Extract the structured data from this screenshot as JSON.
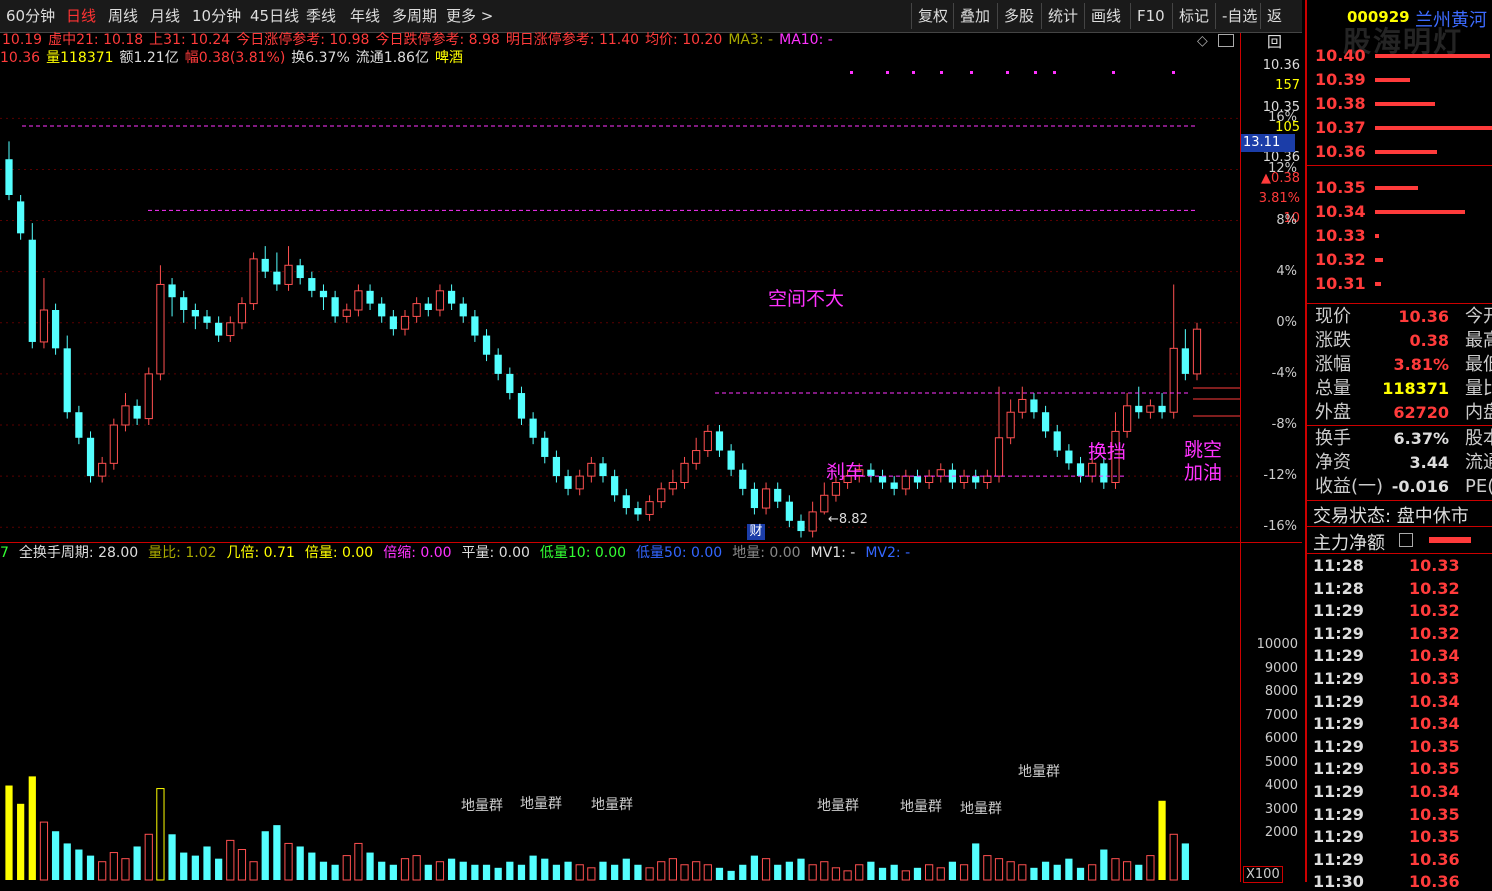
{
  "toolbar": {
    "periods": [
      "60分钟",
      "日线",
      "周线",
      "月线",
      "10分钟",
      "45日线",
      "季线",
      "年线",
      "多周期",
      "更多 >"
    ],
    "active": "日线",
    "actions": [
      "复权",
      "叠加",
      "多股",
      "统计",
      "画线",
      "F10",
      "标记",
      "-自选",
      "返回"
    ]
  },
  "info1": [
    {
      "t": "10.19",
      "c": "#ff3b3b"
    },
    {
      "t": "虚中21: 10.18",
      "c": "#ff3b3b"
    },
    {
      "t": "上31: 10.24",
      "c": "#ff3b3b"
    },
    {
      "t": "今日涨停参考: 10.98",
      "c": "#ff3b3b"
    },
    {
      "t": "今日跌停参考: 8.98",
      "c": "#ff3b3b"
    },
    {
      "t": "明日涨停参考: 11.40",
      "c": "#ff3b3b"
    },
    {
      "t": "均价: 10.20",
      "c": "#ff3b3b"
    },
    {
      "t": "MA3: -",
      "c": "#aaaa00"
    },
    {
      "t": "MA10: -",
      "c": "#ff33ff"
    }
  ],
  "info2": [
    {
      "t": "10.36",
      "c": "#ff3b3b"
    },
    {
      "t": "量118371",
      "c": "#ffff00"
    },
    {
      "t": "额1.21亿",
      "c": "#ddd"
    },
    {
      "t": "幅0.38(3.81%)",
      "c": "#ff3b3b"
    },
    {
      "t": "换6.37%",
      "c": "#ddd"
    },
    {
      "t": "流通1.86亿",
      "c": "#ddd"
    },
    {
      "t": "啤酒",
      "c": "#ffff00"
    }
  ],
  "price_axis": {
    "top_values": [
      {
        "t": "10.36",
        "c": "#ddd"
      },
      {
        "t": "157",
        "c": "#ffff00"
      },
      {
        "t": "10.35",
        "c": "#ddd"
      },
      {
        "t": "105",
        "c": "#ffff00"
      },
      {
        "t": "10.36",
        "c": "#ddd"
      },
      {
        "t": "▲0.38",
        "c": "#ff3b3b"
      },
      {
        "t": "3.81%",
        "c": "#ff3b3b"
      },
      {
        "t": "10",
        "c": "#ff3b3b"
      }
    ],
    "highlight": "13.11",
    "pct_ticks": [
      "16%",
      "12%",
      "8%",
      "4%",
      "0%",
      "-4%",
      "-8%",
      "-12%",
      "-16%"
    ]
  },
  "annotations": {
    "space": "空间不大",
    "brake": "刹车",
    "switch": "换挡",
    "gap1": "跳空",
    "gap2": "加油",
    "low": "←8.82",
    "fin": "财"
  },
  "vol_info": [
    {
      "t": "7",
      "c": "#33ff33"
    },
    {
      "t": "全换手周期: 28.00",
      "c": "#ddd"
    },
    {
      "t": "量比: 1.02",
      "c": "#aaaa00"
    },
    {
      "t": "几倍: 0.71",
      "c": "#ffff00"
    },
    {
      "t": "倍量: 0.00",
      "c": "#ffff00"
    },
    {
      "t": "倍缩: 0.00",
      "c": "#ff33ff"
    },
    {
      "t": "平量: 0.00",
      "c": "#ddd"
    },
    {
      "t": "低量10: 0.00",
      "c": "#33ff33"
    },
    {
      "t": "低量50: 0.00",
      "c": "#3366ff"
    },
    {
      "t": "地量: 0.00",
      "c": "#888"
    },
    {
      "t": "MV1: -",
      "c": "#ddd"
    },
    {
      "t": "MV2: -",
      "c": "#3366ff"
    }
  ],
  "vol_axis": [
    "10000",
    "9000",
    "8000",
    "7000",
    "6000",
    "5000",
    "4000",
    "3000",
    "2000"
  ],
  "vol_unit": "X100",
  "vol_groups": [
    "地量群",
    "地量群",
    "地量群",
    "地量群",
    "地量群",
    "地量群",
    "地量群"
  ],
  "right": {
    "code": "000929",
    "name": "兰州黄河",
    "watermark": "股海明灯",
    "orderbook": [
      {
        "p": "10.40",
        "w": 115
      },
      {
        "p": "10.39",
        "w": 35
      },
      {
        "p": "10.38",
        "w": 60
      },
      {
        "p": "10.37",
        "w": 117
      },
      {
        "p": "10.36",
        "w": 62
      },
      {
        "p": "10.35",
        "w": 43
      },
      {
        "p": "10.34",
        "w": 90
      },
      {
        "p": "10.33",
        "w": 4
      },
      {
        "p": "10.32",
        "w": 8
      },
      {
        "p": "10.31",
        "w": 6
      }
    ],
    "quote": [
      {
        "l": "现价",
        "v": "10.36",
        "c": "#ff3b3b",
        "x": "今开"
      },
      {
        "l": "涨跌",
        "v": "0.38",
        "c": "#ff3b3b",
        "x": "最高"
      },
      {
        "l": "涨幅",
        "v": "3.81%",
        "c": "#ff3b3b",
        "x": "最低"
      },
      {
        "l": "总量",
        "v": "118371",
        "c": "#ffff00",
        "x": "量比"
      },
      {
        "l": "外盘",
        "v": "62720",
        "c": "#ff3b3b",
        "x": "内盘"
      },
      {
        "l": "换手",
        "v": "6.37%",
        "c": "#ddd",
        "x": "股本"
      },
      {
        "l": "净资",
        "v": "3.44",
        "c": "#ddd",
        "x": "流通"
      },
      {
        "l": "收益(一)",
        "v": "-0.016",
        "c": "#ddd",
        "x": "PE(动)"
      }
    ],
    "status": "交易状态: 盘中休市",
    "main_flow": "主力净额",
    "ticks": [
      {
        "t": "11:28",
        "p": "10.33"
      },
      {
        "t": "11:28",
        "p": "10.32"
      },
      {
        "t": "11:29",
        "p": "10.32"
      },
      {
        "t": "11:29",
        "p": "10.32"
      },
      {
        "t": "11:29",
        "p": "10.34"
      },
      {
        "t": "11:29",
        "p": "10.33"
      },
      {
        "t": "11:29",
        "p": "10.34"
      },
      {
        "t": "11:29",
        "p": "10.34"
      },
      {
        "t": "11:29",
        "p": "10.35"
      },
      {
        "t": "11:29",
        "p": "10.35"
      },
      {
        "t": "11:29",
        "p": "10.34"
      },
      {
        "t": "11:29",
        "p": "10.35"
      },
      {
        "t": "11:29",
        "p": "10.35"
      },
      {
        "t": "11:29",
        "p": "10.36"
      },
      {
        "t": "11:30",
        "p": "10.36"
      }
    ]
  },
  "chart_data": {
    "type": "candlestick",
    "pct_range": [
      -17,
      19
    ],
    "reference_lines_pct": [
      15.4,
      8.8,
      -5.5,
      -12.0
    ],
    "candles": [
      [
        12.8,
        10.0,
        14.2,
        9.6
      ],
      [
        9.5,
        7.0,
        10.0,
        6.5
      ],
      [
        6.5,
        -1.5,
        7.8,
        -2.0
      ],
      [
        -1.5,
        1.0,
        3.5,
        -2.0
      ],
      [
        1.0,
        -2.0,
        1.5,
        -2.5
      ],
      [
        -2.0,
        -7.0,
        -1.0,
        -7.5
      ],
      [
        -7.0,
        -9.0,
        -6.5,
        -9.5
      ],
      [
        -9.0,
        -12.0,
        -8.5,
        -12.5
      ],
      [
        -12.0,
        -11.0,
        -10.5,
        -12.5
      ],
      [
        -11.0,
        -8.0,
        -7.5,
        -11.5
      ],
      [
        -8.0,
        -6.5,
        -5.5,
        -8.5
      ],
      [
        -6.5,
        -7.5,
        -6.0,
        -8.0
      ],
      [
        -7.5,
        -4.0,
        -3.5,
        -8.0
      ],
      [
        -4.0,
        3.0,
        4.5,
        -4.5
      ],
      [
        3.0,
        2.0,
        3.5,
        0.5
      ],
      [
        2.0,
        1.0,
        2.5,
        0.0
      ],
      [
        1.0,
        0.5,
        1.5,
        -0.5
      ],
      [
        0.5,
        0.0,
        1.0,
        -0.5
      ],
      [
        0.0,
        -1.0,
        0.5,
        -1.5
      ],
      [
        -1.0,
        0.0,
        0.5,
        -1.5
      ],
      [
        0.0,
        1.5,
        2.0,
        -0.5
      ],
      [
        1.5,
        5.0,
        5.5,
        1.0
      ],
      [
        5.0,
        4.0,
        6.0,
        3.5
      ],
      [
        4.0,
        3.0,
        5.5,
        2.5
      ],
      [
        3.0,
        4.5,
        6.0,
        2.5
      ],
      [
        4.5,
        3.5,
        5.0,
        3.0
      ],
      [
        3.5,
        2.5,
        4.0,
        2.0
      ],
      [
        2.5,
        2.0,
        3.0,
        1.0
      ],
      [
        2.0,
        0.5,
        2.5,
        0.0
      ],
      [
        0.5,
        1.0,
        1.5,
        0.0
      ],
      [
        1.0,
        2.5,
        3.0,
        0.5
      ],
      [
        2.5,
        1.5,
        3.0,
        1.0
      ],
      [
        1.5,
        0.5,
        2.0,
        0.0
      ],
      [
        0.5,
        -0.5,
        1.0,
        -1.0
      ],
      [
        -0.5,
        0.5,
        1.0,
        -1.0
      ],
      [
        0.5,
        1.5,
        2.0,
        0.0
      ],
      [
        1.5,
        1.0,
        2.0,
        0.5
      ],
      [
        1.0,
        2.5,
        3.0,
        0.5
      ],
      [
        2.5,
        1.5,
        3.0,
        1.0
      ],
      [
        1.5,
        0.5,
        2.0,
        0.0
      ],
      [
        0.5,
        -1.0,
        1.0,
        -1.5
      ],
      [
        -1.0,
        -2.5,
        -0.5,
        -3.0
      ],
      [
        -2.5,
        -4.0,
        -2.0,
        -4.5
      ],
      [
        -4.0,
        -5.5,
        -3.5,
        -6.0
      ],
      [
        -5.5,
        -7.5,
        -5.0,
        -8.0
      ],
      [
        -7.5,
        -9.0,
        -7.0,
        -9.5
      ],
      [
        -9.0,
        -10.5,
        -8.5,
        -11.0
      ],
      [
        -10.5,
        -12.0,
        -10.0,
        -12.5
      ],
      [
        -12.0,
        -13.0,
        -11.5,
        -13.5
      ],
      [
        -13.0,
        -12.0,
        -11.5,
        -13.5
      ],
      [
        -12.0,
        -11.0,
        -10.5,
        -12.5
      ],
      [
        -11.0,
        -12.0,
        -10.5,
        -12.5
      ],
      [
        -12.0,
        -13.5,
        -11.5,
        -14.0
      ],
      [
        -13.5,
        -14.5,
        -13.0,
        -15.0
      ],
      [
        -14.5,
        -15.0,
        -14.0,
        -15.5
      ],
      [
        -15.0,
        -14.0,
        -13.5,
        -15.5
      ],
      [
        -14.0,
        -13.0,
        -12.5,
        -14.5
      ],
      [
        -13.0,
        -12.5,
        -11.5,
        -13.5
      ],
      [
        -12.5,
        -11.0,
        -10.5,
        -13.0
      ],
      [
        -11.0,
        -10.0,
        -9.0,
        -11.5
      ],
      [
        -10.0,
        -8.5,
        -8.0,
        -10.5
      ],
      [
        -8.5,
        -10.0,
        -8.0,
        -10.5
      ],
      [
        -10.0,
        -11.5,
        -9.5,
        -12.0
      ],
      [
        -11.5,
        -13.0,
        -11.0,
        -13.5
      ],
      [
        -13.0,
        -14.5,
        -12.5,
        -15.0
      ],
      [
        -14.5,
        -13.0,
        -12.5,
        -15.0
      ],
      [
        -13.0,
        -14.0,
        -12.5,
        -14.5
      ],
      [
        -14.0,
        -15.5,
        -13.5,
        -16.0
      ],
      [
        -15.5,
        -16.3,
        -15.0,
        -16.8
      ],
      [
        -16.3,
        -14.8,
        -14.0,
        -16.8
      ],
      [
        -14.8,
        -13.5,
        -12.5,
        -15.0
      ],
      [
        -13.5,
        -12.5,
        -12.0,
        -14.0
      ],
      [
        -12.5,
        -12.0,
        -11.5,
        -13.0
      ],
      [
        -12.0,
        -11.5,
        -11.0,
        -12.5
      ],
      [
        -11.5,
        -12.0,
        -11.0,
        -12.5
      ],
      [
        -12.0,
        -12.5,
        -11.5,
        -13.0
      ],
      [
        -12.5,
        -13.0,
        -12.0,
        -13.5
      ],
      [
        -13.0,
        -12.0,
        -11.5,
        -13.5
      ],
      [
        -12.0,
        -12.5,
        -11.5,
        -13.0
      ],
      [
        -12.5,
        -12.0,
        -11.5,
        -13.0
      ],
      [
        -12.0,
        -11.5,
        -11.0,
        -12.5
      ],
      [
        -11.5,
        -12.5,
        -11.0,
        -13.0
      ],
      [
        -12.5,
        -12.0,
        -11.5,
        -13.0
      ],
      [
        -12.0,
        -12.5,
        -11.5,
        -13.0
      ],
      [
        -12.5,
        -12.0,
        -11.5,
        -13.0
      ],
      [
        -12.0,
        -9.0,
        -5.0,
        -12.5
      ],
      [
        -9.0,
        -7.0,
        -6.0,
        -9.5
      ],
      [
        -7.0,
        -6.0,
        -5.0,
        -7.5
      ],
      [
        -6.0,
        -7.0,
        -5.5,
        -7.5
      ],
      [
        -7.0,
        -8.5,
        -6.5,
        -9.0
      ],
      [
        -8.5,
        -10.0,
        -8.0,
        -10.5
      ],
      [
        -10.0,
        -11.0,
        -9.5,
        -11.5
      ],
      [
        -11.0,
        -12.0,
        -10.5,
        -12.5
      ],
      [
        -12.0,
        -11.0,
        -10.5,
        -12.5
      ],
      [
        -11.0,
        -12.5,
        -10.5,
        -13.0
      ],
      [
        -12.5,
        -8.5,
        -7.0,
        -13.0
      ],
      [
        -8.5,
        -6.5,
        -5.5,
        -9.0
      ],
      [
        -6.5,
        -7.0,
        -5.0,
        -7.5
      ],
      [
        -7.0,
        -6.5,
        -6.0,
        -7.5
      ],
      [
        -6.5,
        -7.0,
        -5.5,
        -7.5
      ],
      [
        -7.0,
        -2.0,
        3.0,
        -7.5
      ],
      [
        -2.0,
        -4.0,
        -0.5,
        -4.5
      ],
      [
        -4.0,
        -0.5,
        0.0,
        -4.5
      ]
    ],
    "volumes": [
      3100,
      2500,
      3400,
      1900,
      1600,
      1200,
      1000,
      800,
      600,
      900,
      700,
      1100,
      1500,
      3000,
      1500,
      900,
      800,
      1100,
      700,
      1300,
      1000,
      600,
      1600,
      1800,
      1200,
      1100,
      900,
      600,
      500,
      800,
      1200,
      900,
      600,
      500,
      700,
      800,
      500,
      600,
      700,
      600,
      500,
      500,
      400,
      600,
      500,
      800,
      700,
      500,
      600,
      500,
      400,
      600,
      500,
      700,
      500,
      400,
      600,
      700,
      500,
      600,
      500,
      400,
      300,
      500,
      800,
      700,
      500,
      600,
      700,
      500,
      600,
      400,
      300,
      500,
      600,
      400,
      500,
      300,
      400,
      500,
      400,
      600,
      500,
      1200,
      800,
      700,
      600,
      500,
      400,
      600,
      500,
      700,
      400,
      500,
      1000,
      700,
      600,
      500,
      800,
      2600,
      1500,
      1200
    ]
  }
}
